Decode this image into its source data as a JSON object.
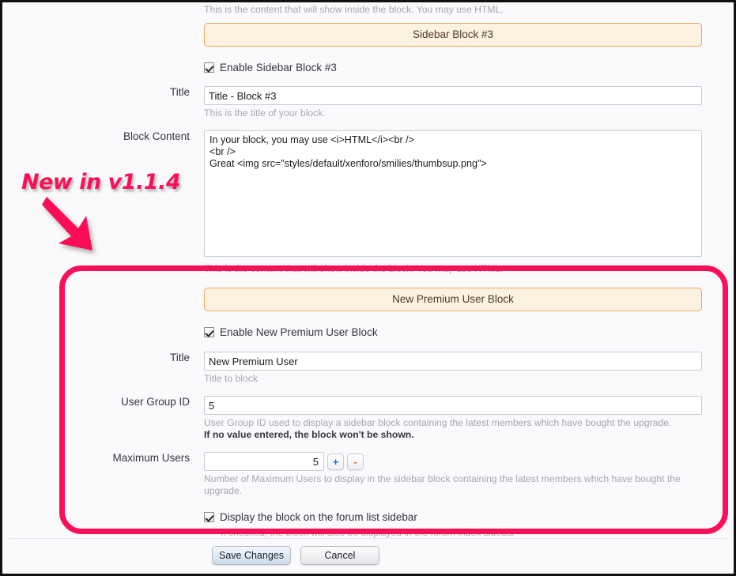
{
  "page": {
    "background_color": "#fafafc",
    "accent_orange": "#e8a75c",
    "annotation_color": "#f91058"
  },
  "annotation": {
    "text": "New in v1.1.4",
    "arrow_name": "arrow-down-right",
    "highlight_shape": "rounded-rectangle"
  },
  "top_section": {
    "leading_hint": "This is the content that will show inside the block. You may use HTML.",
    "bar_title": "Sidebar Block #3",
    "enable_checkbox_label": "Enable Sidebar Block #3",
    "enable_checked": true,
    "rows": [
      {
        "label": "Title",
        "value": "Title - Block #3",
        "hint": "This is the title of your block."
      },
      {
        "label": "Block Content",
        "value": "In your block, you may use <i>HTML</i><br />\n<br />\nGreat <img src=\"styles/default/xenforo/smilies/thumbsup.png\">",
        "hint": "This is the content that will show inside the block. You may use HTML."
      }
    ]
  },
  "premium_section": {
    "bar_title": "New Premium User Block",
    "enable_checkbox_label": "Enable New Premium User Block",
    "enable_checked": true,
    "rows": [
      {
        "label": "Title",
        "value": "New Premium User",
        "hint": "Title to block"
      },
      {
        "label": "User Group ID",
        "value": "5",
        "hint": "User Group ID used to display a sidebar block containing the latest members which have bought the upgrade.",
        "hint_strong": "If no value entered, the block won't be shown."
      },
      {
        "label": "Maximum Users",
        "value": "5",
        "hint": "Number of Maximum Users to display in the sidebar block containing the latest members which have bought the upgrade.",
        "stepper_plus": "+",
        "stepper_minus": "-"
      }
    ],
    "display_checkbox_label": "Display the block on the forum list sidebar",
    "display_checked": true,
    "display_hint": "If checked, the block will also be displayed in the forum index sidebar"
  },
  "footer": {
    "save_label": "Save Changes",
    "cancel_label": "Cancel"
  }
}
